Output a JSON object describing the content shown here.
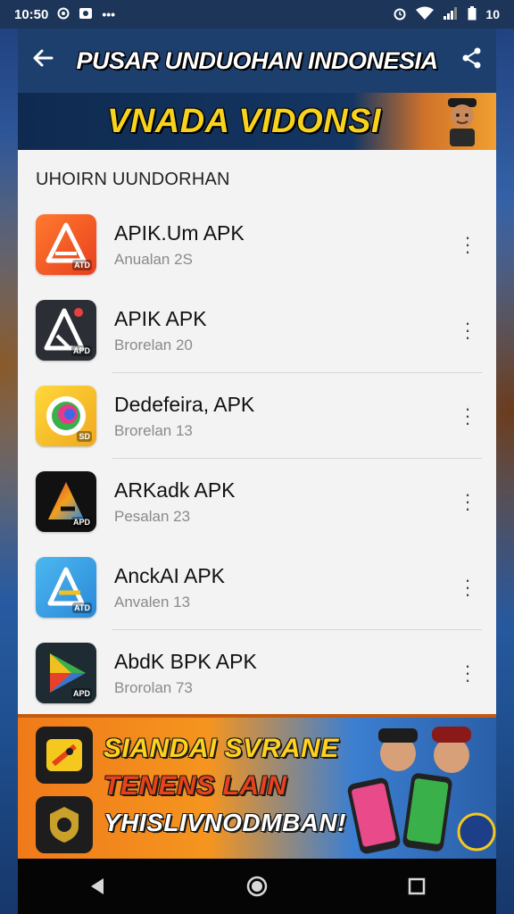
{
  "status_bar": {
    "time": "10:50",
    "icons": [
      "sim-icon",
      "photo-icon",
      "more-icon",
      "alarm-icon",
      "wifi-icon",
      "signal-icon",
      "battery-icon"
    ],
    "battery_label": "10"
  },
  "app_bar": {
    "title": "PUSAR UNDUOHAN INDONESIA",
    "back_icon": "back-arrow-icon",
    "share_icon": "share-icon"
  },
  "top_banner": {
    "text": "VNADA VIDONSI"
  },
  "section": {
    "title": "UHOIRN UUNDORHAN"
  },
  "apps": [
    {
      "title": "APIK.Um APK",
      "subtitle": "Anualan 2S",
      "icon_color": "#f0582a",
      "icon": "triangle-a-icon",
      "badge": "ATD"
    },
    {
      "title": "APIK APK",
      "subtitle": "Brorelan 20",
      "icon_color": "#2b2f35",
      "icon": "triangle-a-icon",
      "badge": "APD"
    },
    {
      "title": "Dedefeira, APK",
      "subtitle": "Brorelan 13",
      "icon_color": "#f5c22a",
      "icon": "swirl-icon",
      "badge": "SD"
    },
    {
      "title": "ARKadk APK",
      "subtitle": "Pesalan 23",
      "icon_color": "#111111",
      "icon": "triangle-a-icon",
      "badge": "APD"
    },
    {
      "title": "AnckAI APK",
      "subtitle": "Anvalen 13",
      "icon_color": "#3aa0e6",
      "icon": "triangle-a-icon",
      "badge": "ATD"
    },
    {
      "title": "AbdK BPK APK",
      "subtitle": "Brorolan 73",
      "icon_color": "#1f2b33",
      "icon": "triangle-a-icon",
      "badge": "APD"
    }
  ],
  "bottom_banner": {
    "line1": "SIANDAI SVRANE",
    "line2": "TENENS LAIN",
    "line3": "YHISLIVNODMBAN!"
  },
  "nav_bar": {
    "back": "nav-back-icon",
    "home": "nav-home-icon",
    "recents": "nav-recents-icon"
  }
}
